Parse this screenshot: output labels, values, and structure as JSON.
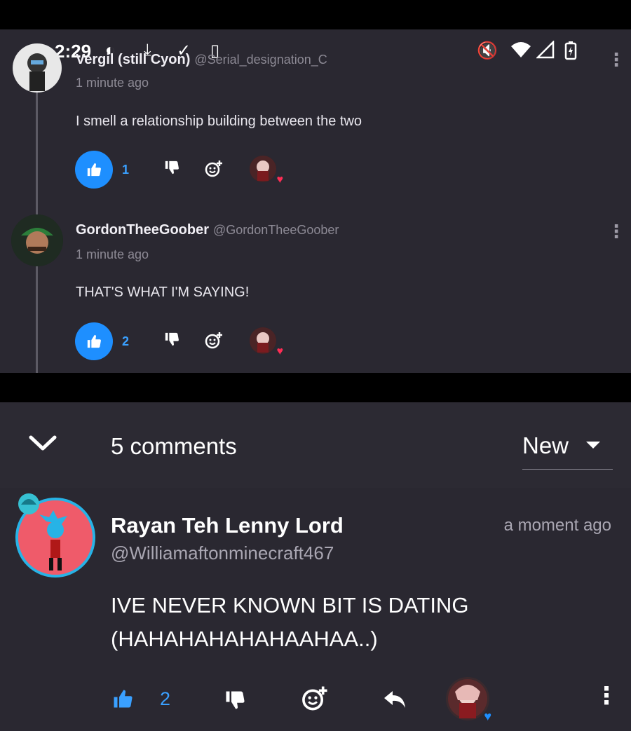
{
  "status_bar": {
    "time": "2:29"
  },
  "thread": [
    {
      "name": "Vergil (still Cyon)",
      "handle": "@Serial_designation_C",
      "time": "1 minute ago",
      "text": "I smell a relationship building between the two",
      "likes": "1"
    },
    {
      "name": "GordonTheeGoober",
      "handle": "@GordonTheeGoober",
      "time": "1 minute ago",
      "text": "THAT'S WHAT I'M SAYING!",
      "likes": "2"
    }
  ],
  "comments_header": {
    "count_label": "5 comments",
    "sort_label": "New"
  },
  "main_comment": {
    "name": "Rayan Teh Lenny Lord",
    "handle": "@Williamaftonminecraft467",
    "time": "a moment ago",
    "text_line1": "IVE NEVER KNOWN BIT IS DATING",
    "text_line2": "(HAHAHAHAHAHAAHAA..)",
    "likes": "2"
  },
  "colors": {
    "accent": "#1e8fff",
    "heart": "#ff2d55",
    "background": "#2a2831"
  }
}
